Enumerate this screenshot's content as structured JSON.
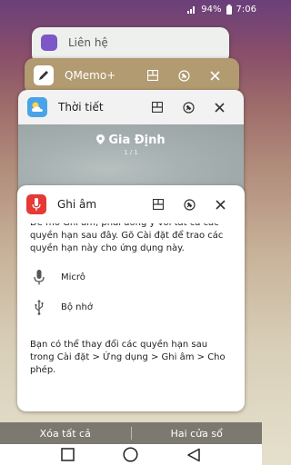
{
  "status": {
    "battery": "94%",
    "time": "7:06"
  },
  "cards": {
    "lien_he": {
      "title": "Liên hệ"
    },
    "qmemo": {
      "title": "QMemo+"
    },
    "weather": {
      "title": "Thời tiết",
      "location": "Gia Định",
      "page": "1 / 1"
    },
    "ghiam": {
      "title": "Ghi âm",
      "intro": "Để mở Ghi âm, phải đồng ý với tất cả các quyền hạn sau đây. Gõ Cài đặt để trao các quyền hạn này cho ứng dụng này.",
      "permissions": [
        {
          "label": "Micrô",
          "icon": "microphone-icon"
        },
        {
          "label": "Bộ nhớ",
          "icon": "storage-icon"
        }
      ],
      "footer": "Bạn có thể thay đổi các quyền hạn sau trong Cài đặt > Ứng dụng > Ghi âm > Cho phép."
    }
  },
  "actions": {
    "clear_all": "Xóa tất cả",
    "dual_window": "Hai cửa sổ"
  },
  "colors": {
    "qmemo_card": "#b29a71",
    "ghiam_icon": "#e53935",
    "weather_icon": "#4aa3e8"
  }
}
